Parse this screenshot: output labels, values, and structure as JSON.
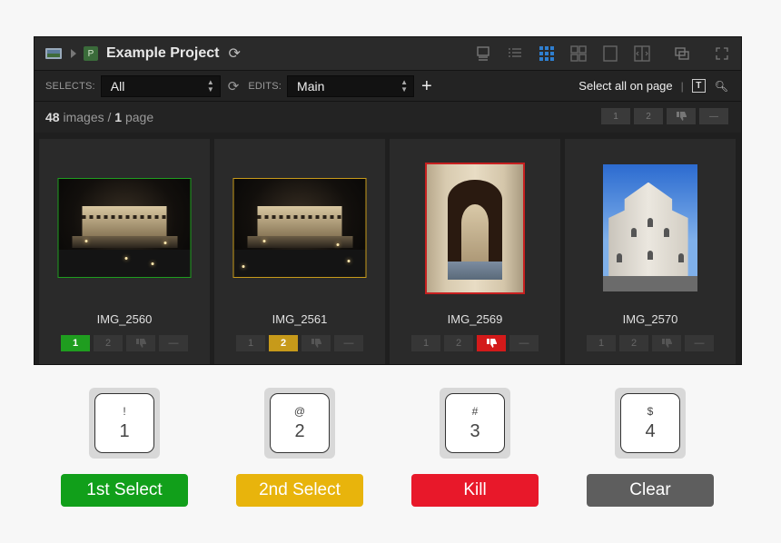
{
  "titlebar": {
    "project_icon_letter": "P",
    "title": "Example Project"
  },
  "filterbar": {
    "selects_label": "SELECTS:",
    "selects_value": "All",
    "edits_label": "EDITS:",
    "edits_value": "Main",
    "add_label": "+",
    "select_all_label": "Select all on page",
    "divider": "|",
    "text_icon_label": "T"
  },
  "countbar": {
    "image_count": "48",
    "images_label": "images",
    "slash": "/",
    "page_count": "1",
    "page_label": "page",
    "bulk_buttons": [
      "1",
      "2",
      "",
      ""
    ]
  },
  "images": [
    {
      "name": "IMG_2560",
      "status": "1st",
      "border_color": "#1f9d1f"
    },
    {
      "name": "IMG_2561",
      "status": "2nd",
      "border_color": "#c79a1a"
    },
    {
      "name": "IMG_2569",
      "status": "kill",
      "border_color": "#c62020"
    },
    {
      "name": "IMG_2570",
      "status": "none",
      "border_color": ""
    }
  ],
  "rating_labels": {
    "first": "1",
    "second": "2",
    "minus": "—"
  },
  "keys": [
    {
      "symbol": "!",
      "number": "1"
    },
    {
      "symbol": "@",
      "number": "2"
    },
    {
      "symbol": "#",
      "number": "3"
    },
    {
      "symbol": "$",
      "number": "4"
    }
  ],
  "legend": [
    {
      "label": "1st Select",
      "color": "#119f1a"
    },
    {
      "label": "2nd Select",
      "color": "#e8b40c"
    },
    {
      "label": "Kill",
      "color": "#e8182a"
    },
    {
      "label": "Clear",
      "color": "#5e5e5e"
    }
  ],
  "colors": {
    "app_bg": "#1f1f1f",
    "card_bg": "#2a2a2a",
    "accent_blue": "#2f7fd0"
  }
}
